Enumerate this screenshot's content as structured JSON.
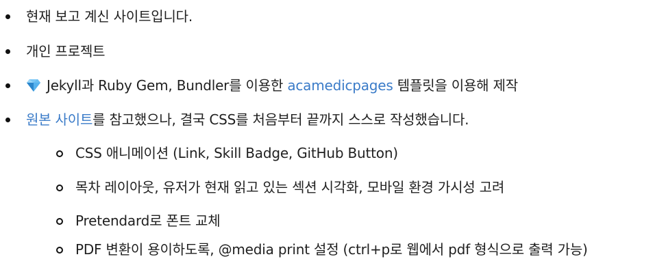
{
  "items": [
    {
      "text": "현재 보고 계신 사이트입니다."
    },
    {
      "text": "개인 프로젝트"
    },
    {
      "icon": "gem-icon",
      "before": "Jekyll과 Ruby Gem, Bundler를 이용한 ",
      "link": "acamedicpages",
      "after": " 템플릿을 이용해 제작"
    },
    {
      "link": "원본 사이트",
      "after": "를 참고했으나, 결국 CSS를 처음부터 끝까지 스스로 작성했습니다."
    }
  ],
  "subitems": [
    {
      "text": "CSS 애니메이션 (Link, Skill Badge, GitHub Button)"
    },
    {
      "text": "목차 레이아웃, 유저가 현재 읽고 있는 섹션 시각화, 모바일 환경 가시성 고려"
    },
    {
      "text": "Pretendard로 폰트 교체"
    },
    {
      "text": "PDF 변환이 용이하도록, @media print 설정 (ctrl+p로 웹에서 pdf 형식으로 출력 가능)"
    }
  ],
  "colors": {
    "link": "#3a7bc8",
    "text": "#1f1f1f",
    "gem": "#3aa0e8"
  }
}
